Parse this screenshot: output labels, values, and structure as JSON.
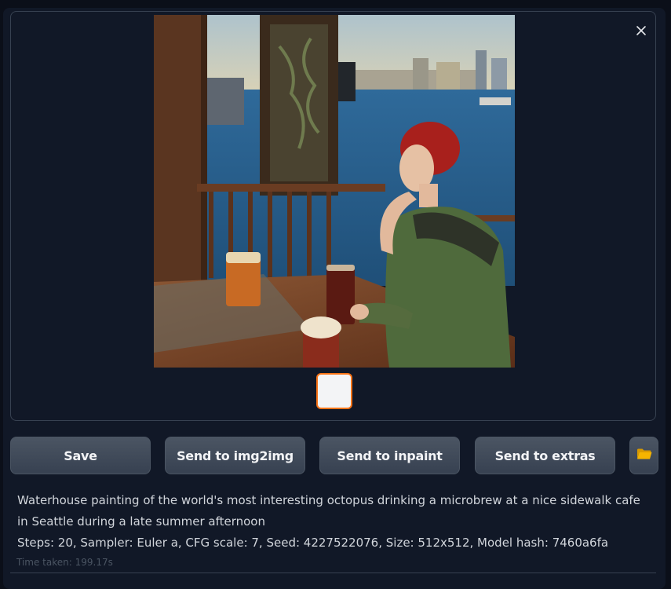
{
  "gallery": {
    "close_icon": "close-icon",
    "thumbnail_selected": true
  },
  "actions": {
    "save_label": "Save",
    "img2img_label": "Send to img2img",
    "inpaint_label": "Send to inpaint",
    "extras_label": "Send to extras",
    "folder_icon": "folder-icon"
  },
  "generation_info": {
    "prompt": "Waterhouse painting of the world's most interesting octopus drinking a microbrew at a nice sidewalk cafe in Seattle during a late summer afternoon",
    "parameters": "Steps: 20, Sampler: Euler a, CFG scale: 7, Seed: 4227522076, Size: 512x512, Model hash: 7460a6fa",
    "time_taken": "Time taken: 199.17s"
  },
  "colors": {
    "background": "#0b0f19",
    "panel": "#111827",
    "button": "#374151",
    "accent": "#f97316",
    "folder": "#f5b400"
  }
}
